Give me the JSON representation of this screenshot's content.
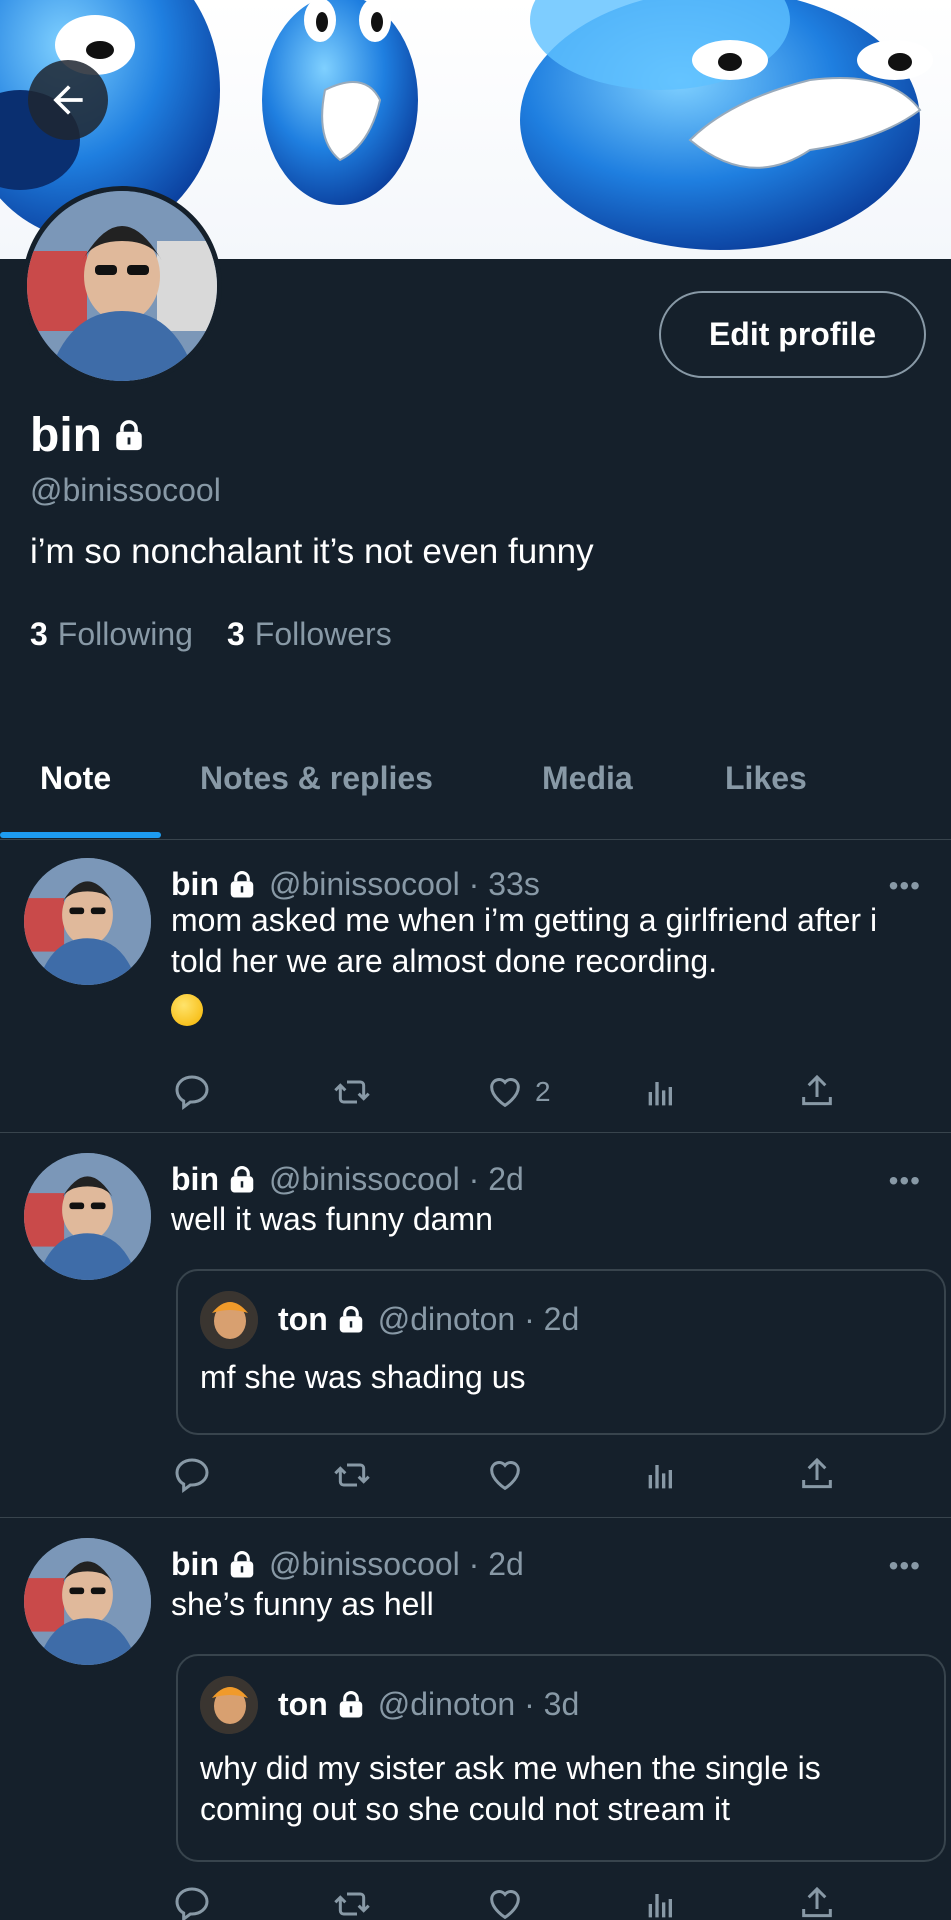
{
  "header": {
    "back_label": "Back"
  },
  "profile": {
    "name": "bin",
    "handle": "@binissocool",
    "bio": "i’m so nonchalant it’s not even funny",
    "following_count": "3",
    "following_label": "Following",
    "followers_count": "3",
    "followers_label": "Followers",
    "edit_label": "Edit profile"
  },
  "tabs": [
    {
      "label": "Note",
      "active": true
    },
    {
      "label": "Notes & replies",
      "active": false
    },
    {
      "label": "Media",
      "active": false
    },
    {
      "label": "Likes",
      "active": false
    }
  ],
  "posts": [
    {
      "name": "bin",
      "meta": "@binissocool · 33s",
      "text": "mom asked me when i’m getting a girlfriend after i told her we are almost done recording.",
      "emoji": "raised-eyebrow-emoji",
      "likes": "2"
    },
    {
      "name": "bin",
      "meta": "@binissocool · 2d",
      "text": "well it was funny damn",
      "quote": {
        "name": "ton",
        "meta": "@dinoton · 2d",
        "text": "mf she was shading us"
      }
    },
    {
      "name": "bin",
      "meta": "@binissocool · 2d",
      "text": "she’s funny as hell",
      "quote": {
        "name": "ton",
        "meta": "@dinoton · 3d",
        "text": "why did my sister ask me when the single is coming out so she could not stream it"
      }
    }
  ],
  "colors": {
    "background": "#15202b",
    "muted": "#8899a6",
    "accent": "#1d9bf0",
    "border": "#38444d"
  },
  "icons": [
    "back-arrow-icon",
    "lock-icon",
    "reply-icon",
    "retweet-icon",
    "heart-icon",
    "analytics-icon",
    "share-icon",
    "more-icon"
  ]
}
